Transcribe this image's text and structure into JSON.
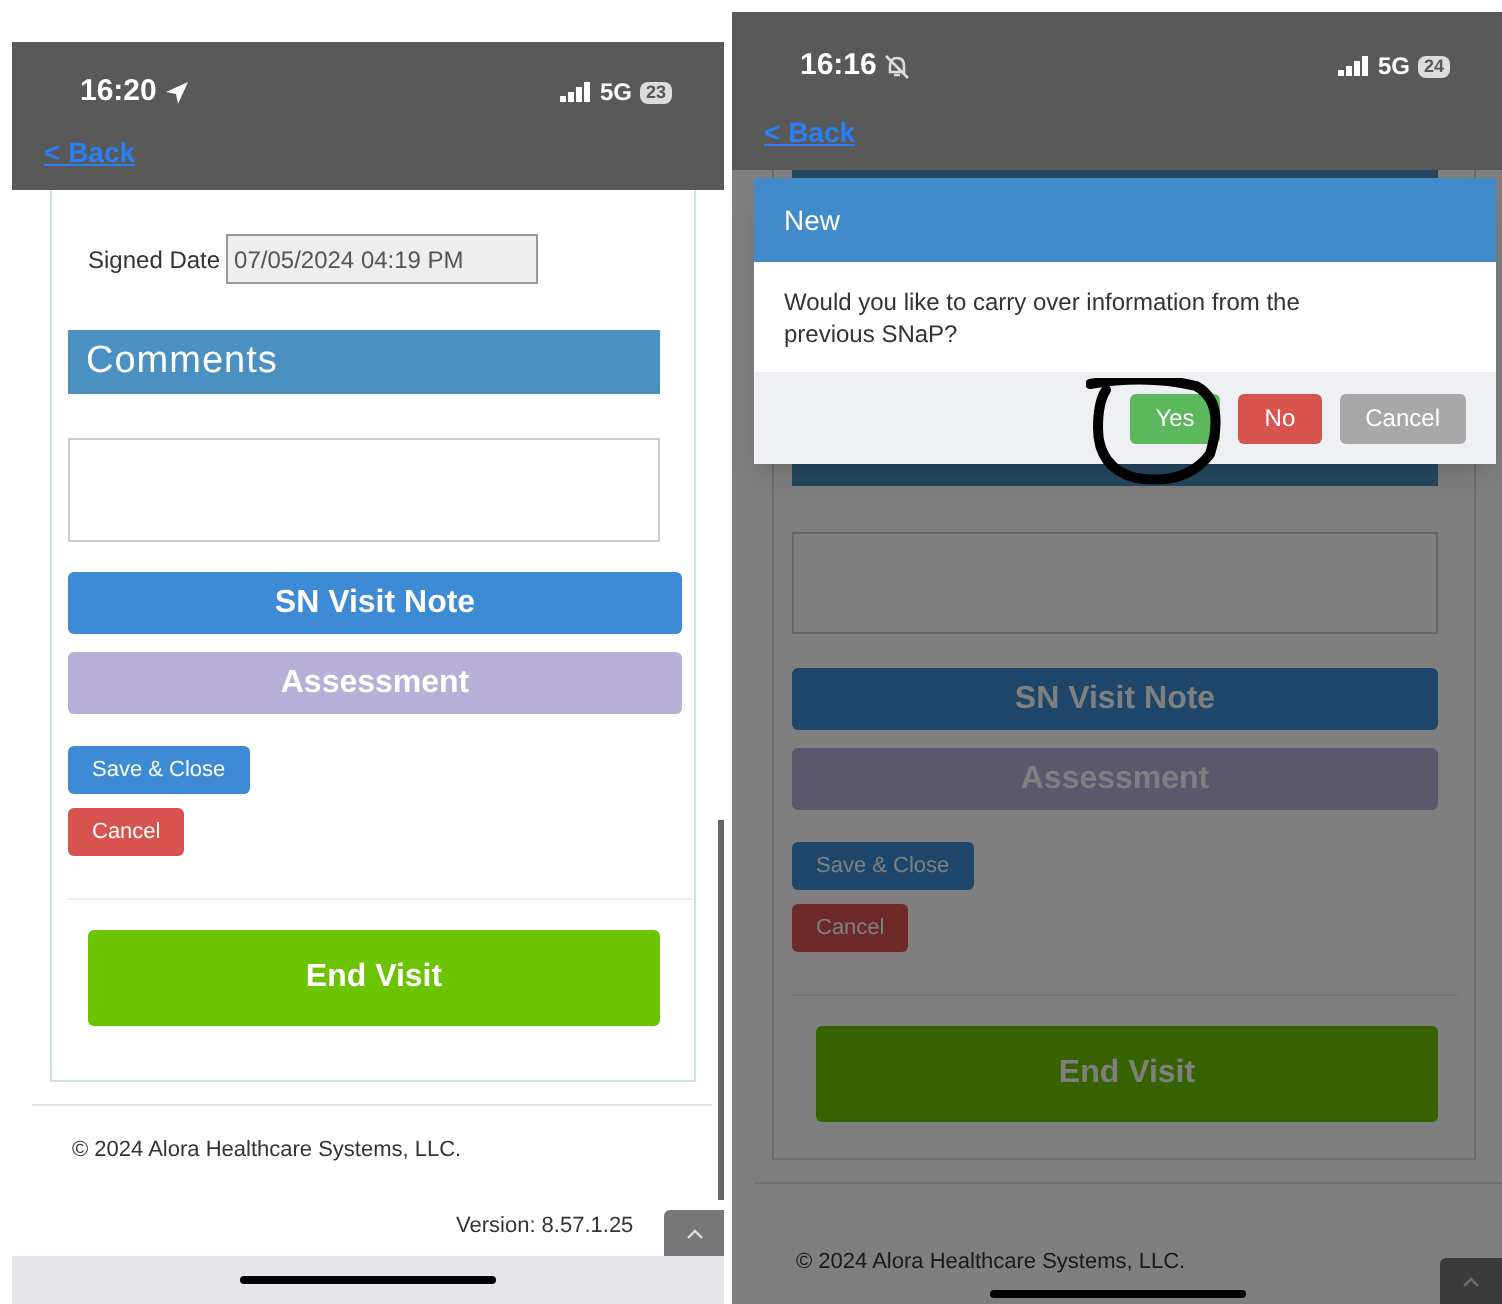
{
  "screens": [
    {
      "status_bar": {
        "time": "16:20",
        "network": "5G",
        "battery": "23"
      },
      "back_link": "< Back",
      "signed_date": {
        "label": "Signed Date",
        "value": "07/05/2024 04:19 PM"
      },
      "comments_header": "Comments",
      "sn_visit_note_button": "SN Visit Note",
      "assessment_button": "Assessment",
      "save_close_button": "Save & Close",
      "cancel_button": "Cancel",
      "end_visit_button": "End Visit",
      "footer": {
        "copyright": "© 2024 Alora Healthcare Systems, LLC.",
        "version": "Version: 8.57.1.25"
      }
    },
    {
      "status_bar": {
        "time": "16:16",
        "network": "5G",
        "battery": "24"
      },
      "back_link": "< Back",
      "sn_visit_note_button": "SN Visit Note",
      "assessment_button": "Assessment",
      "save_close_button": "Save & Close",
      "cancel_button": "Cancel",
      "end_visit_button": "End Visit",
      "footer": {
        "copyright": "© 2024 Alora Healthcare Systems, LLC."
      },
      "dialog": {
        "title": "New",
        "message": "Would you like to carry over information from the previous SNaP?",
        "buttons": [
          {
            "label": "Yes",
            "kind": "success"
          },
          {
            "label": "No",
            "kind": "danger"
          },
          {
            "label": "Cancel",
            "kind": "default"
          }
        ]
      }
    }
  ]
}
